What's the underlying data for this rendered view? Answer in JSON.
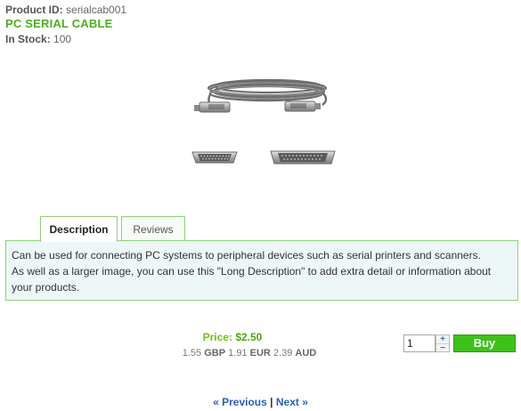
{
  "product": {
    "id_label": "Product ID:",
    "id_value": "serialcab001",
    "title": "PC SERIAL CABLE",
    "stock_label": "In Stock:",
    "stock_value": "100"
  },
  "tabs": [
    {
      "label": "Description",
      "active": true
    },
    {
      "label": "Reviews",
      "active": false
    }
  ],
  "description": {
    "line1": "Can be used for connecting PC systems to peripheral devices such as serial printers and scanners.",
    "line2": "As well as a larger image, you can use this \"Long Description\" to add extra detail or information about your products."
  },
  "price": {
    "label": "Price:",
    "amount": "$2.50",
    "conversions": [
      {
        "value": "1.55",
        "currency": "GBP"
      },
      {
        "value": "1.91",
        "currency": "EUR"
      },
      {
        "value": "2.39",
        "currency": "AUD"
      }
    ]
  },
  "cart": {
    "quantity": "1",
    "increment_label": "+",
    "decrement_label": "−",
    "buy_label": "Buy"
  },
  "pager": {
    "previous": "« Previous",
    "separator": "|",
    "next": "Next »"
  },
  "colors": {
    "title_green": "#4caf1f",
    "buy_green": "#3ec11b",
    "link_blue": "#2a61b5",
    "desc_bg": "#eef7f7",
    "border_green": "#8fd07a"
  }
}
